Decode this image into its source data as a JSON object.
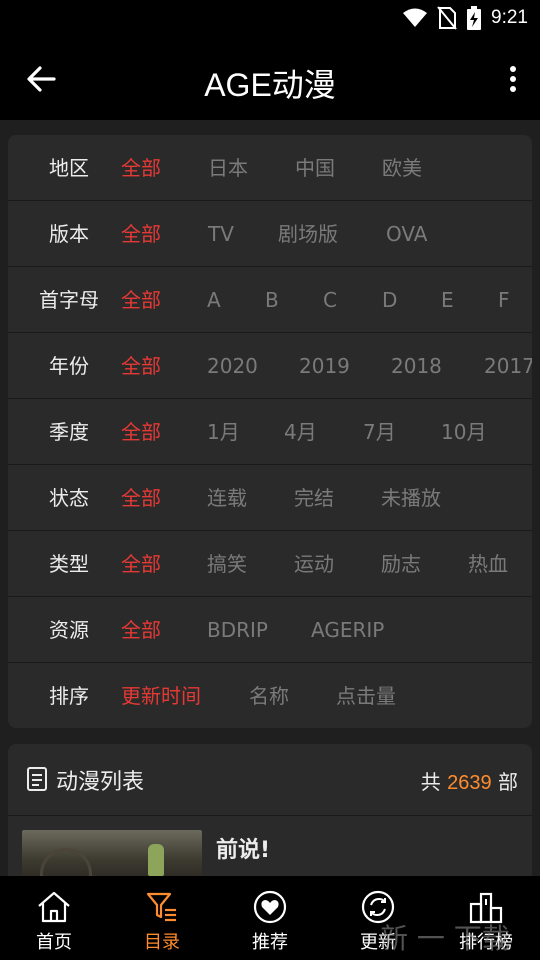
{
  "status_bar": {
    "time": "9:21"
  },
  "app_bar": {
    "title": "AGE动漫"
  },
  "filters": [
    {
      "label": "地区",
      "options": [
        "全部",
        "日本",
        "中国",
        "欧美"
      ]
    },
    {
      "label": "版本",
      "options": [
        "全部",
        "TV",
        "剧场版",
        "OVA"
      ]
    },
    {
      "label": "首字母",
      "options": [
        "全部",
        "A",
        "B",
        "C",
        "D",
        "E",
        "F"
      ]
    },
    {
      "label": "年份",
      "options": [
        "全部",
        "2020",
        "2019",
        "2018",
        "2017"
      ]
    },
    {
      "label": "季度",
      "options": [
        "全部",
        "1月",
        "4月",
        "7月",
        "10月"
      ]
    },
    {
      "label": "状态",
      "options": [
        "全部",
        "连载",
        "完结",
        "未播放"
      ]
    },
    {
      "label": "类型",
      "options": [
        "全部",
        "搞笑",
        "运动",
        "励志",
        "热血"
      ]
    },
    {
      "label": "资源",
      "options": [
        "全部",
        "BDRIP",
        "AGERIP"
      ]
    },
    {
      "label": "排序",
      "options": [
        "更新时间",
        "名称",
        "点击量"
      ]
    }
  ],
  "list": {
    "title": "动漫列表",
    "count_prefix": "共",
    "count": "2639",
    "count_suffix": "部",
    "items": [
      {
        "name": "前说!"
      }
    ]
  },
  "bottom_nav": [
    {
      "label": "首页",
      "icon": "home-icon"
    },
    {
      "label": "目录",
      "icon": "filter-list-icon",
      "active": true
    },
    {
      "label": "推荐",
      "icon": "heart-icon"
    },
    {
      "label": "更新",
      "icon": "refresh-icon"
    },
    {
      "label": "排行榜",
      "icon": "podium-icon"
    }
  ],
  "watermark": "新 一 下载",
  "colors": {
    "accent_red": "#e53935",
    "accent_orange": "#ff8c2e",
    "background": "#1f1f1f",
    "card": "#2a2a2a"
  }
}
